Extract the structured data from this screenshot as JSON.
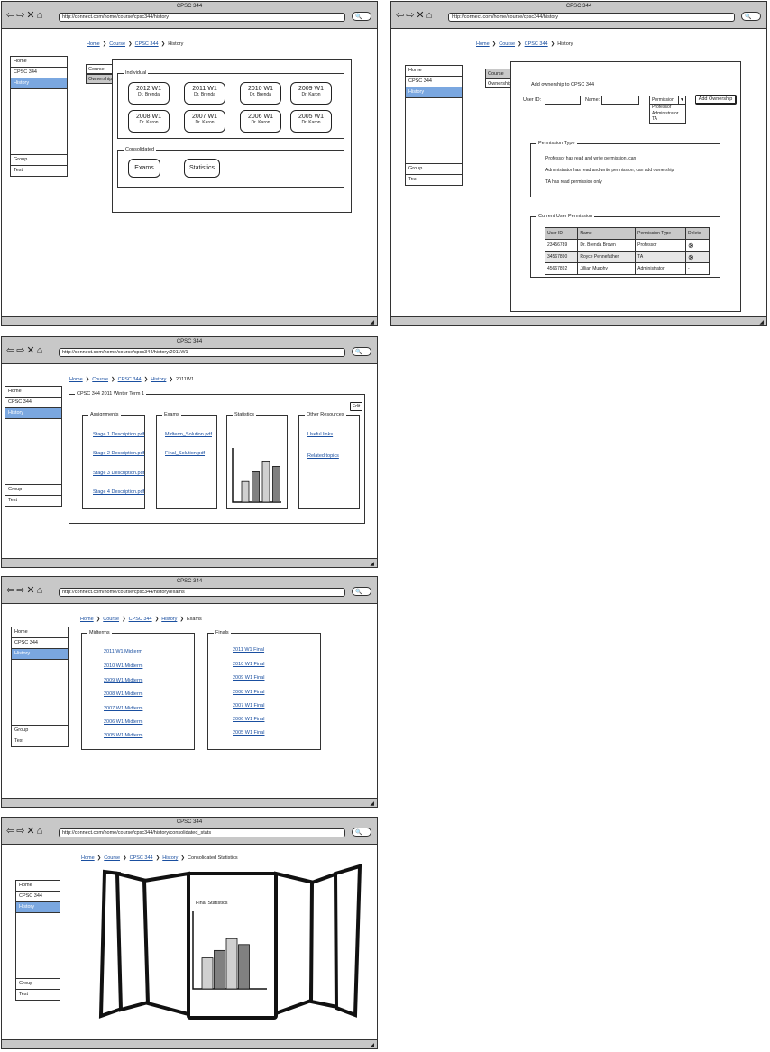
{
  "browser": {
    "title": "CPSC 344",
    "urls": {
      "w1": "http://connect.com/home/course/cpsc344/history",
      "w2": "http://connect.com/home/course/cpsc344/history",
      "w3": "http://connect.com/home/course/cpsc344/history/2011W1",
      "w4": "http://connect.com/home/course/cpsc344/history/exams",
      "w5": "http://connect.com/home/course/cpsc344/history/consolidated_stats"
    },
    "nav_glyphs": "⇦⇨✕⌂",
    "search_glyph": "🔍",
    "grip_glyph": "◢"
  },
  "breadcrumb": {
    "home": "Home",
    "course": "Course",
    "cpsc": "CPSC 344",
    "history": "History",
    "term": "2011W1",
    "exams": "Exams",
    "stats": "Consolidated Statistics",
    "sep": "❯"
  },
  "sidebar": {
    "home": "Home",
    "cpsc": "CPSC 344",
    "history": "History",
    "group": "Group",
    "test": "Test"
  },
  "tabs": {
    "course": "Course",
    "ownership": "Ownership"
  },
  "w1": {
    "individual_legend": "Individual",
    "terms": [
      {
        "term": "2012 W1",
        "prof": "Dr. Brenda"
      },
      {
        "term": "2011 W1",
        "prof": "Dr. Brenda"
      },
      {
        "term": "2010 W1",
        "prof": "Dr. Brenda"
      },
      {
        "term": "2009 W1",
        "prof": "Dr. Karon"
      },
      {
        "term": "2008 W1",
        "prof": "Dr. Karon"
      },
      {
        "term": "2007 W1",
        "prof": "Dr. Karon"
      },
      {
        "term": "2006 W1",
        "prof": "Dr. Karon"
      },
      {
        "term": "2005 W1",
        "prof": "Dr. Karon"
      }
    ],
    "consolidated_legend": "Consolidated",
    "exams_btn": "Exams",
    "stats_btn": "Statistics"
  },
  "w2": {
    "add_heading": "Add ownership to CPSC 344",
    "userid_label": "User ID:",
    "name_label": "Name:",
    "permission_select": "Permission",
    "permission_options": [
      "Professor",
      "Administrator",
      "TA"
    ],
    "add_btn": "Add Ownership",
    "ptype_legend": "Permission Type",
    "ptype_lines": [
      "Professor has read and write permission, can",
      "Administrator has read and write permission, can add ownership",
      "TA has read permission only"
    ],
    "current_legend": "Current User Permission",
    "table_headers": [
      "User ID",
      "Name",
      "Permission Type",
      "Delete"
    ],
    "table_rows": [
      {
        "id": "23456789",
        "name": "Dr. Brenda Brown",
        "type": "Professor",
        "del": "⊗"
      },
      {
        "id": "34567890",
        "name": "Royce Pennefather",
        "type": "TA",
        "del": "⊗"
      },
      {
        "id": "45667892",
        "name": "Jillian Murphy",
        "type": "Administrator",
        "del": "-"
      }
    ]
  },
  "w3": {
    "legend": "CPSC 344 2011 Winter Term 1",
    "edit": "Edit",
    "assignments_legend": "Assignments",
    "assignments": [
      "Stage 1 Description.pdf",
      "Stage 2 Description.pdf",
      "Stage 3 Description.pdf",
      "Stage 4 Description.pdf"
    ],
    "exams_legend": "Exams",
    "exams": [
      "Midterm_Solution.pdf",
      "Final_Solution.pdf"
    ],
    "stats_legend": "Statistics",
    "other_legend": "Other Resources",
    "other": [
      "Useful links",
      "Related topics"
    ]
  },
  "w4": {
    "midterms_legend": "Midterms",
    "midterms": [
      "2011 W1 Midterm",
      "2010 W1 Midterm",
      "2009 W1 Midterm",
      "2008 W1 Midterm",
      "2007 W1 Midterm",
      "2006 W1 Midterm",
      "2005 W1 Midterm"
    ],
    "finals_legend": "Finals",
    "finals": [
      "2011 W1 Final",
      "2010 W1 Final",
      "2009 W1 Final",
      "2008 W1 Final",
      "2007 W1 Final",
      "2006 W1 Final",
      "2005 W1 Final"
    ]
  },
  "w5": {
    "card_title": "Final Statistics"
  },
  "chart_data": [
    {
      "type": "bar",
      "categories": [
        "1",
        "2",
        "3",
        "4"
      ],
      "values": [
        38,
        56,
        76,
        66
      ],
      "ylim": [
        0,
        100
      ],
      "colors": [
        "#d0d0d0",
        "#808080",
        "#d0d0d0",
        "#808080"
      ]
    },
    {
      "type": "bar",
      "categories": [
        "1",
        "2",
        "3",
        "4"
      ],
      "values": [
        42,
        52,
        68,
        60
      ],
      "ylim": [
        0,
        100
      ],
      "colors": [
        "#d0d0d0",
        "#808080",
        "#d0d0d0",
        "#808080"
      ]
    }
  ]
}
